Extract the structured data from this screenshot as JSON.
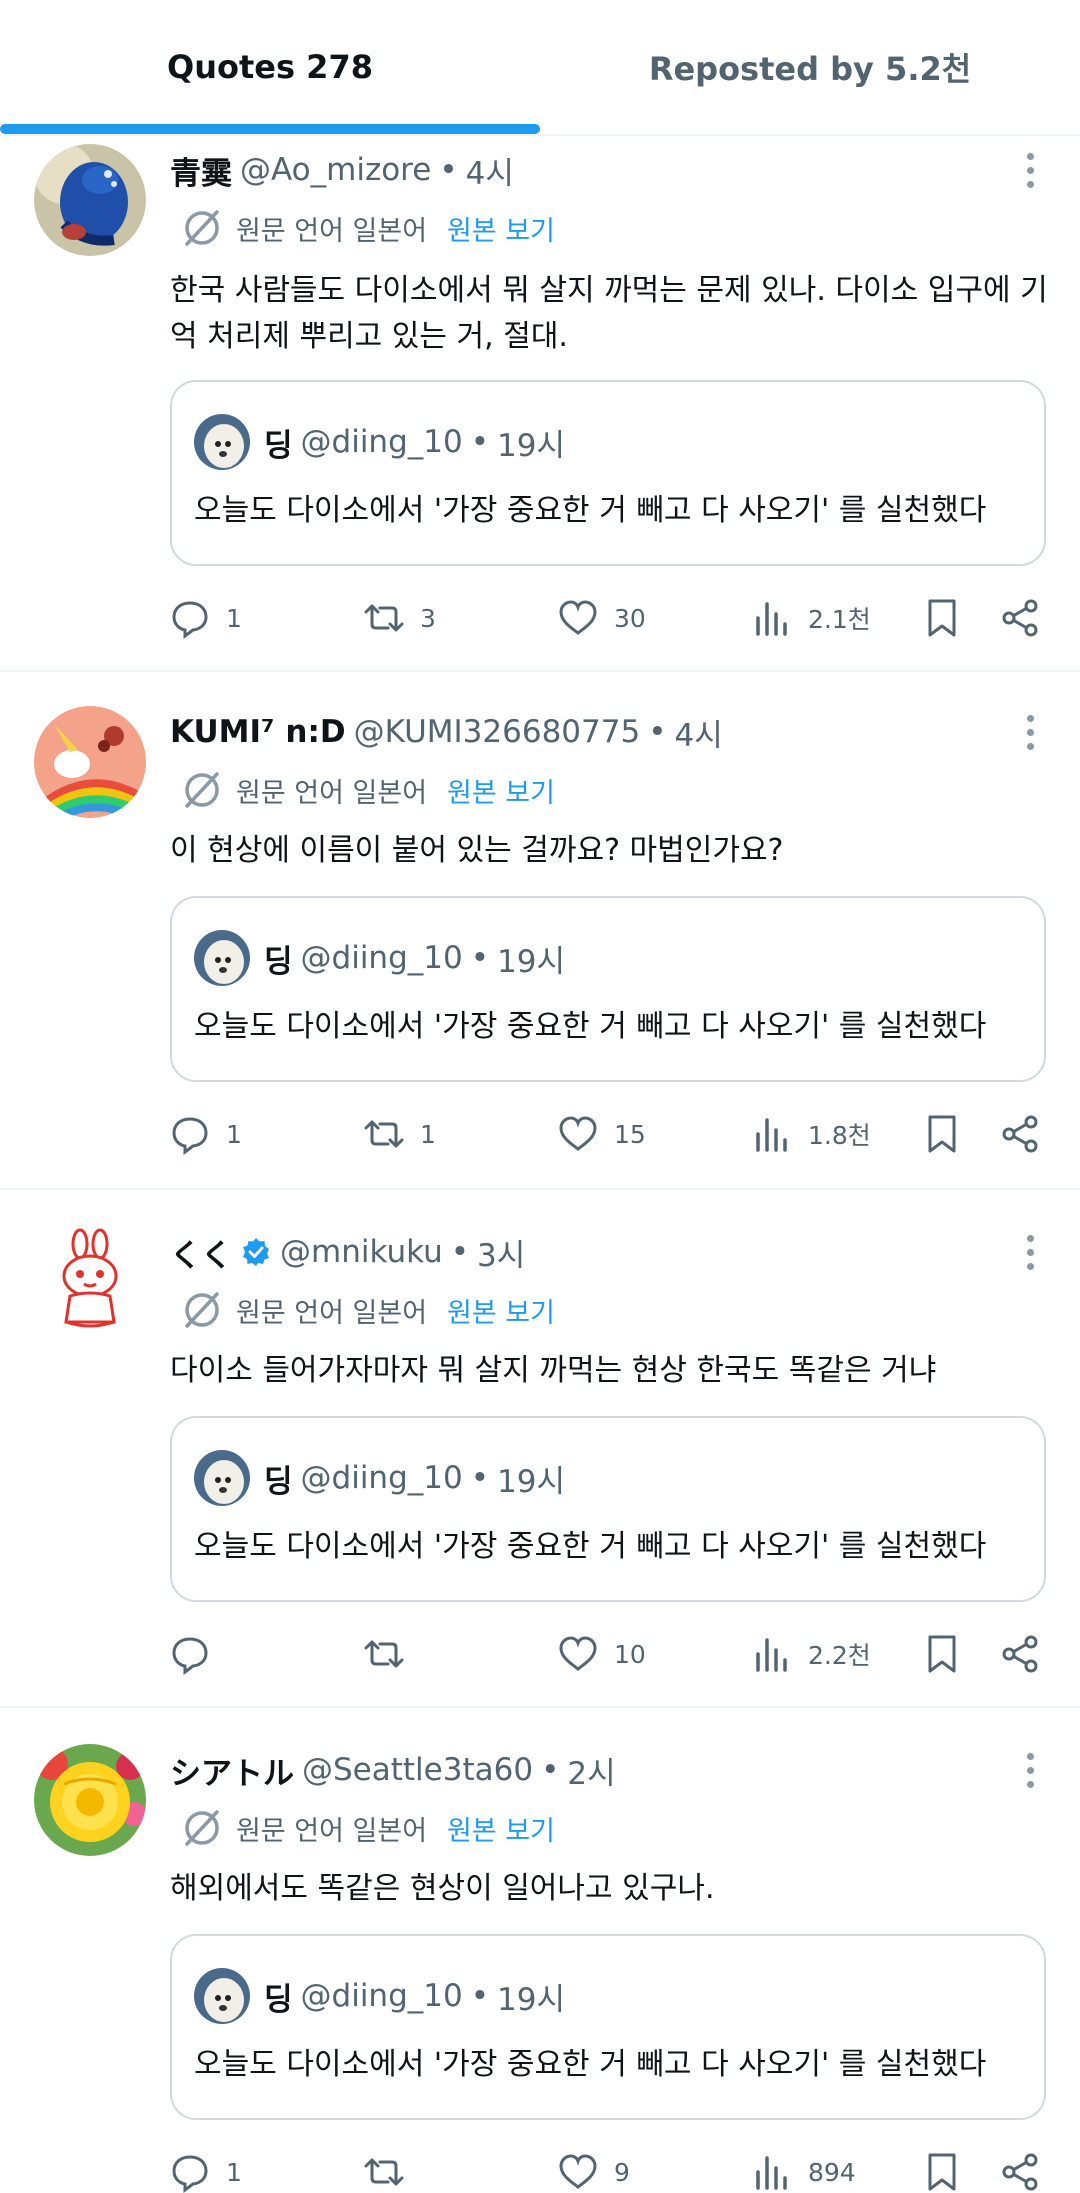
{
  "tabs": [
    {
      "label": "Quotes 278"
    },
    {
      "label": "Reposted by 5.2천"
    }
  ],
  "translate": {
    "text": "원문 언어 일본어",
    "link": "원본 보기"
  },
  "quoted": {
    "name": "딩",
    "handle": "@diing_10",
    "time": "19시",
    "text": "오늘도 다이소에서 '가장 중요한 거 빼고 다 사오기' 를 실천했다"
  },
  "posts": [
    {
      "name": "青霙",
      "handle": "@Ao_mizore",
      "time": "4시",
      "text": "한국 사람들도 다이소에서 뭐 살지 까먹는 문제 있나. 다이소 입구에 기억 처리제 뿌리고 있는 거, 절대.",
      "replies": "1",
      "reposts": "3",
      "likes": "30",
      "views": "2.1천"
    },
    {
      "name": "KUMI⁷ n:D",
      "handle": "@KUMI326680775",
      "time": "4시",
      "text": "이 현상에 이름이 붙어 있는 걸까요? 마법인가요?",
      "replies": "1",
      "reposts": "1",
      "likes": "15",
      "views": "1.8천"
    },
    {
      "name": "くく",
      "handle": "@mnikuku",
      "time": "3시",
      "text": "다이소 들어가자마자 뭐 살지 까먹는 현상 한국도 똑같은 거냐",
      "replies": "",
      "reposts": "",
      "likes": "10",
      "views": "2.2천"
    },
    {
      "name": "シアトル",
      "handle": "@Seattle3ta60",
      "time": "2시",
      "text": "해외에서도 똑같은 현상이 일어나고 있구나.",
      "replies": "1",
      "reposts": "",
      "likes": "9",
      "views": "894"
    }
  ],
  "colors": {
    "accent": "#1d9bf0",
    "text": "#0f1419",
    "secondary": "#536471",
    "border": "#cfd9de"
  },
  "icons": [
    "reply-icon",
    "repost-icon",
    "like-icon",
    "views-icon",
    "bookmark-icon",
    "share-icon",
    "translate-icon",
    "verified-icon",
    "more-icon"
  ]
}
